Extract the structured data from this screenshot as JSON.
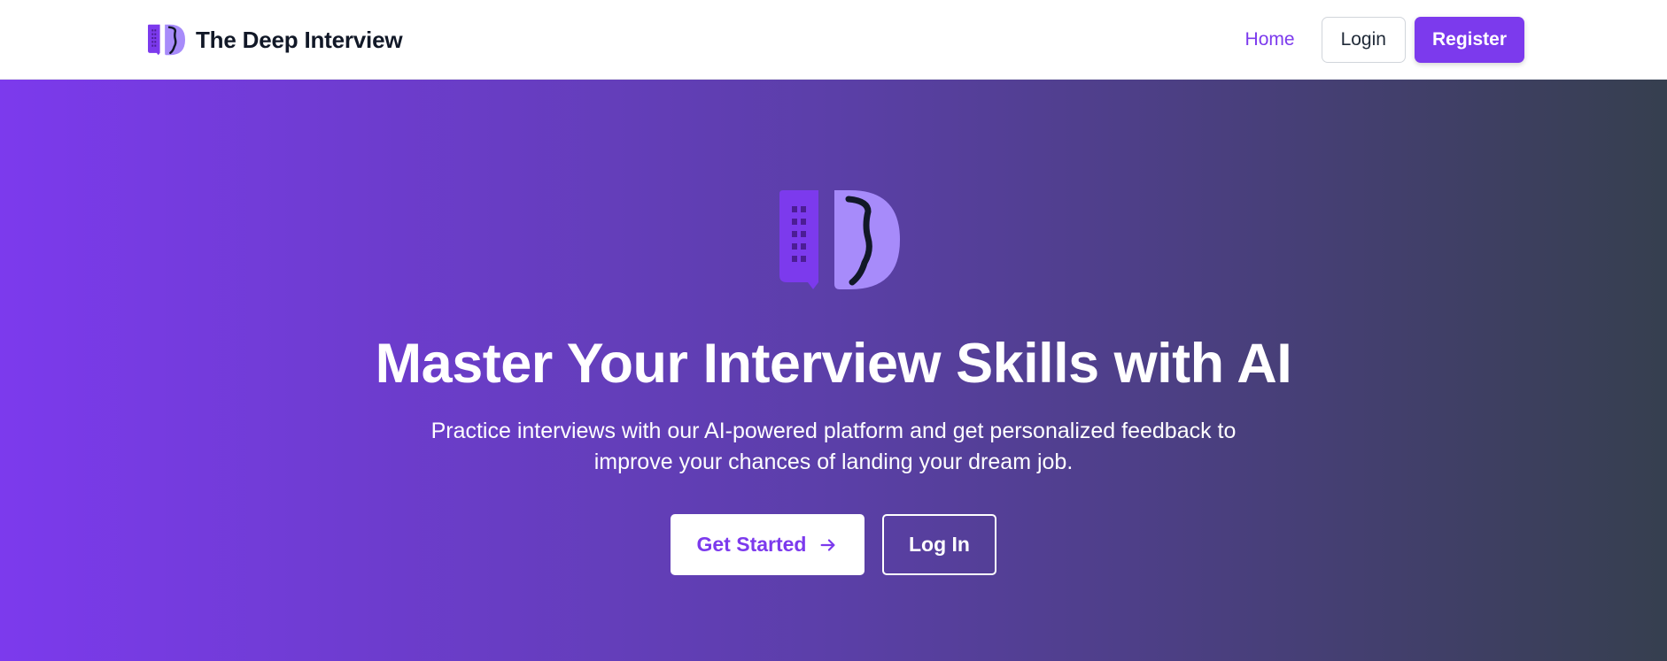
{
  "brand": {
    "name": "The Deep Interview",
    "logo_icon": "deep-interview-logo",
    "color_primary": "#7c3aed",
    "color_light": "#a78bfa"
  },
  "nav": {
    "home_label": "Home",
    "login_label": "Login",
    "register_label": "Register"
  },
  "hero": {
    "title": "Master Your Interview Skills with AI",
    "subtitle": "Practice interviews with our AI-powered platform and get personalized feedback to improve your chances of landing your dream job.",
    "get_started_label": "Get Started",
    "get_started_icon": "arrow-right-icon",
    "log_in_label": "Log In",
    "gradient": [
      "#7c3aed",
      "#5b3fa8",
      "#363f4f"
    ]
  }
}
